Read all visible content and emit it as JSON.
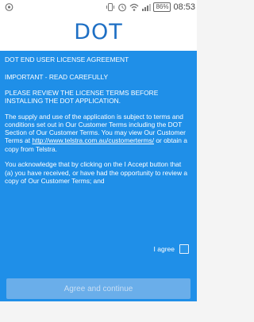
{
  "status_bar": {
    "battery": "86%",
    "time": "08:53",
    "icons": [
      "notification-icon",
      "vibrate-icon",
      "alarm-icon",
      "wifi-icon",
      "signal-icon",
      "battery-icon"
    ]
  },
  "header": {
    "title": "DOT"
  },
  "license": {
    "heading": "DOT END USER LICENSE AGREEMENT",
    "important": "IMPORTANT - READ CAREFULLY",
    "review": "PLEASE REVIEW THE LICENSE TERMS BEFORE INSTALLING THE DOT APPLICATION.",
    "supply_text": "The supply and use of the application is subject to terms and conditions set out in Our Customer Terms including the DOT Section of Our Customer Terms. You may view Our Customer Terms at ",
    "link_text": "http://www.telstra.com.au/customerterms/",
    "supply_suffix": " or obtain a copy from Telstra.",
    "acknowledge_1": "You acknowledge that by clicking on the I Accept button that",
    "acknowledge_2": "(a) you have received, or have had the opportunity to review a copy of Our Customer Terms; and"
  },
  "agree": {
    "label": "I agree",
    "checked": false
  },
  "continue_button": {
    "label": "Agree and continue",
    "enabled": false
  },
  "colors": {
    "panel": "#1f8fe8",
    "title": "#1e6fc4",
    "button_disabled": "#6aaeea"
  }
}
